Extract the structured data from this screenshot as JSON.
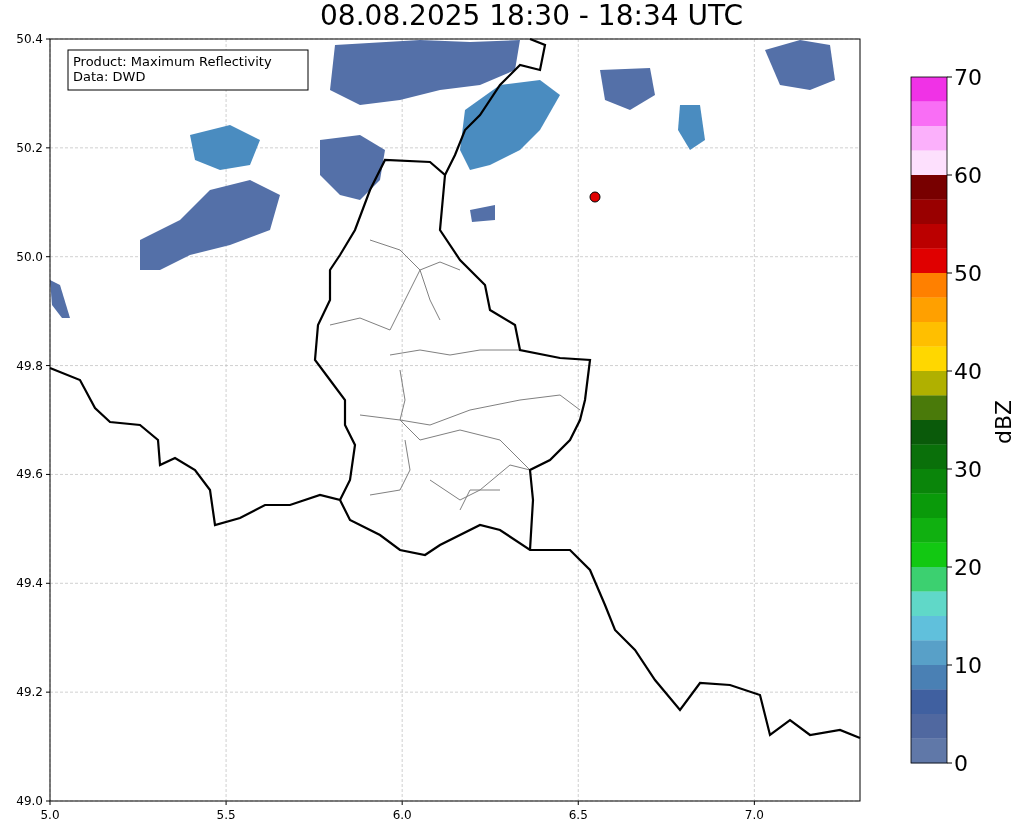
{
  "title": "08.08.2025 18:30 - 18:34 UTC",
  "info_box": [
    "Product: Maximum Reflectivity",
    "Data: DWD"
  ],
  "x_ticks": [
    "5.0",
    "5.5",
    "6.0",
    "6.5",
    "7.0"
  ],
  "y_ticks": [
    "50.4",
    "50.2",
    "50.0",
    "49.8",
    "49.6",
    "49.4",
    "49.2",
    "49.0"
  ],
  "colorbar": {
    "label": "dBZ",
    "ticks": [
      "70",
      "60",
      "50",
      "40",
      "30",
      "20",
      "10",
      "0"
    ],
    "segments": [
      {
        "color": "#f032e6"
      },
      {
        "color": "#f96ef5"
      },
      {
        "color": "#fbb0fb"
      },
      {
        "color": "#fde0fd"
      },
      {
        "color": "#780000"
      },
      {
        "color": "#990000"
      },
      {
        "color": "#bb0000"
      },
      {
        "color": "#e00000"
      },
      {
        "color": "#ff8000"
      },
      {
        "color": "#ffa000"
      },
      {
        "color": "#ffbf00"
      },
      {
        "color": "#ffd700"
      },
      {
        "color": "#b0b000"
      },
      {
        "color": "#4a7a0a"
      },
      {
        "color": "#0a5a0a"
      },
      {
        "color": "#0a700a"
      },
      {
        "color": "#0a850a"
      },
      {
        "color": "#0a9a0a"
      },
      {
        "color": "#10b010"
      },
      {
        "color": "#12c812"
      },
      {
        "color": "#3cd070"
      },
      {
        "color": "#60d8c8"
      },
      {
        "color": "#60c0dc"
      },
      {
        "color": "#58a0c8"
      },
      {
        "color": "#4a80b4"
      },
      {
        "color": "#4060a0"
      },
      {
        "color": "#5068a0"
      },
      {
        "color": "#6078a8"
      }
    ]
  }
}
